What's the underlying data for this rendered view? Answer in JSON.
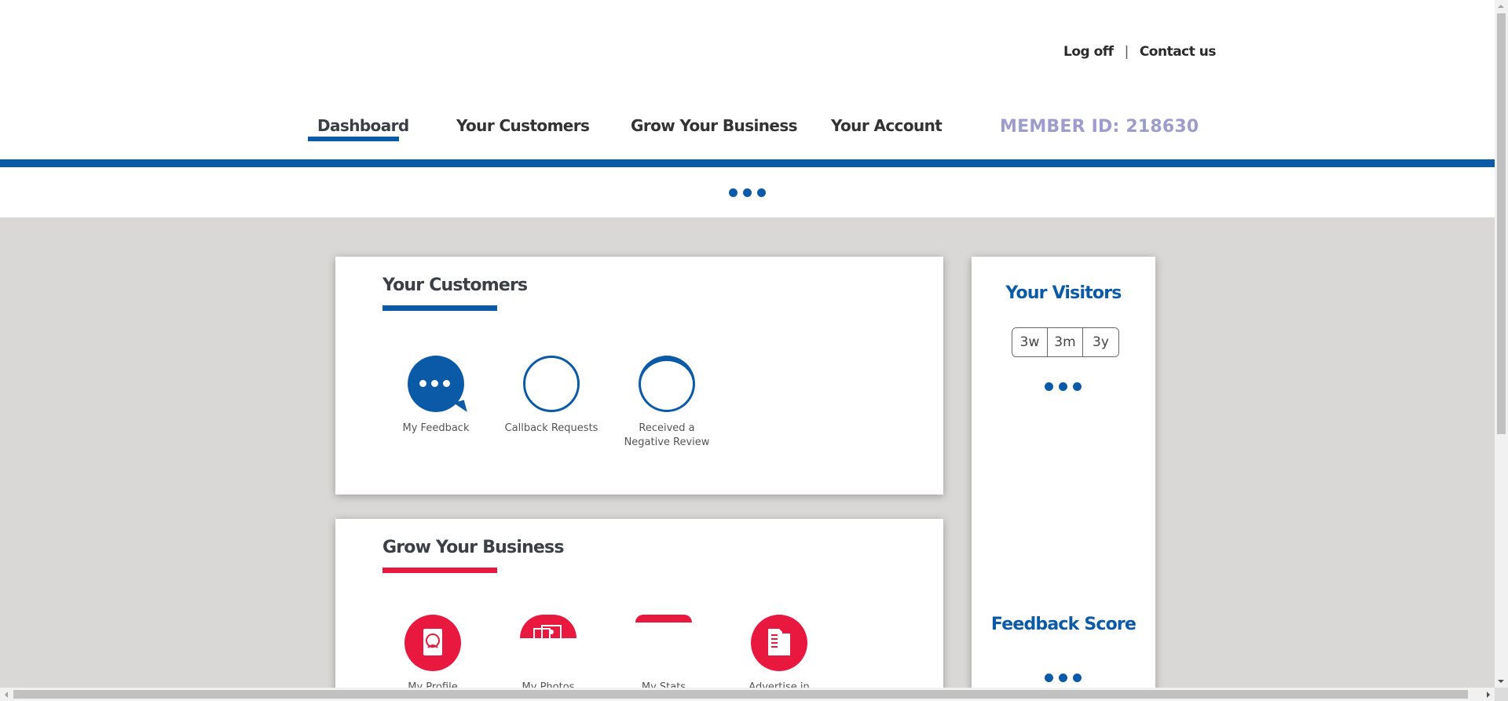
{
  "header": {
    "log_off": "Log off",
    "separator": "|",
    "contact_us": "Contact us"
  },
  "nav": {
    "items": [
      {
        "label": "Dashboard",
        "active": true
      },
      {
        "label": "Your Customers"
      },
      {
        "label": "Grow Your Business"
      },
      {
        "label": "Your Account"
      }
    ],
    "member_id": "MEMBER ID: 218630"
  },
  "customers_card": {
    "title": "Your Customers",
    "accent": "#0b5aa8",
    "tiles": [
      {
        "label": "My Feedback",
        "icon": "chat-bubble-icon"
      },
      {
        "label": "Callback Requests",
        "icon": "circle-outline-icon"
      },
      {
        "label": "Received a Negative Review",
        "icon": "circle-outline-icon"
      }
    ]
  },
  "grow_card": {
    "title": "Grow Your Business",
    "accent": "#e8183f",
    "tiles": [
      {
        "label": "My Profile",
        "icon": "profile-icon"
      },
      {
        "label": "My Photos",
        "icon": "photos-icon"
      },
      {
        "label": "My Stats",
        "icon": "stats-icon"
      },
      {
        "label": "Advertise in",
        "icon": "advertise-icon"
      }
    ]
  },
  "visitors_card": {
    "title": "Your Visitors",
    "ranges": [
      "3w",
      "3m",
      "3y"
    ],
    "feedback_title": "Feedback Score"
  },
  "colors": {
    "brand_blue": "#0b5aa8",
    "brand_red": "#e8183f",
    "member_id": "#9c9ccd",
    "background_grey": "#d9d8d6"
  }
}
